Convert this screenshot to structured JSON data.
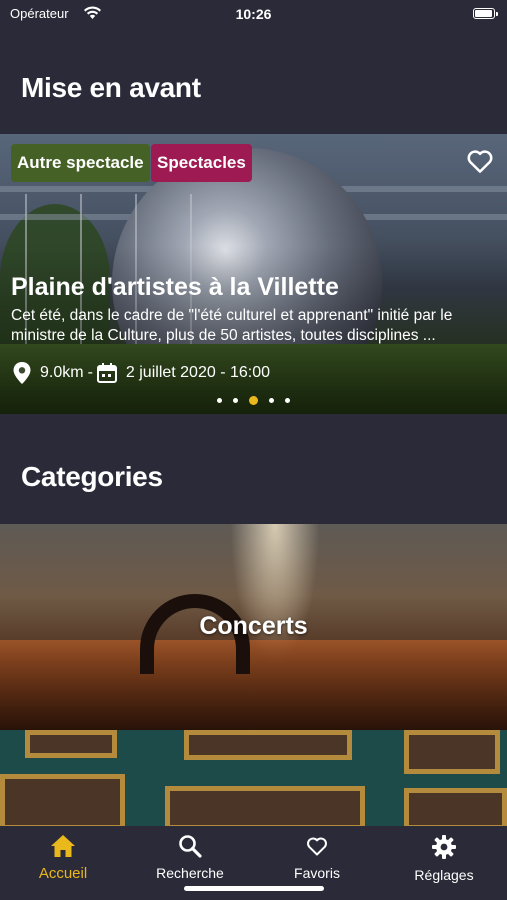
{
  "status_bar": {
    "carrier": "Opérateur",
    "time": "10:26",
    "battery_level": 1.0
  },
  "featured_section": {
    "title": "Mise en avant",
    "event": {
      "tags": [
        {
          "label": "Autre spectacle",
          "color": "#466126"
        },
        {
          "label": "Spectacles",
          "color": "#9d1a52"
        }
      ],
      "title": "Plaine d'artistes à la Villette",
      "description": "Cet été, dans le cadre de \"l'été culturel et apprenant\" initié par le ministre de la Culture, plus de 50 artistes, toutes disciplines ...",
      "distance": "9.0km",
      "separator": "-",
      "date": "2 juillet 2020 - 16:00",
      "favorite_icon": "heart-outline-icon"
    },
    "carousel": {
      "page_count": 5,
      "active_index": 2
    }
  },
  "categories_section": {
    "title": "Categories",
    "items": [
      {
        "label": "Concerts"
      },
      {
        "label": ""
      }
    ]
  },
  "tab_bar": {
    "active_color": "#e9b81c",
    "tabs": [
      {
        "label": "Accueil",
        "icon": "home-icon",
        "active": true
      },
      {
        "label": "Recherche",
        "icon": "search-icon",
        "active": false
      },
      {
        "label": "Favoris",
        "icon": "heart-icon",
        "active": false
      },
      {
        "label": "Réglages",
        "icon": "gear-icon",
        "active": false
      }
    ]
  }
}
